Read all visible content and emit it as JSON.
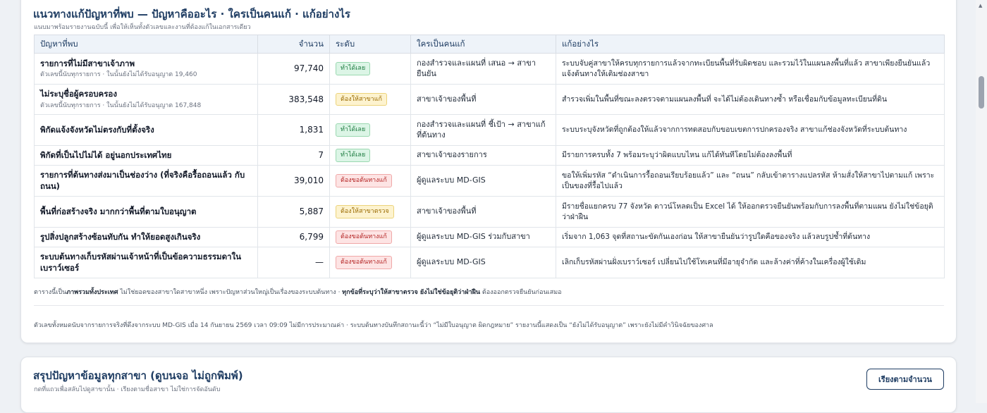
{
  "section1": {
    "title": "แนวทางแก้ปัญหาที่พบ — ปัญหาคืออะไร · ใครเป็นคนแก้ · แก้อย่างไร",
    "subtitle": "แนบมาพร้อมรายงานฉบับนี้ เพื่อให้เห็นทั้งตัวเลขและงานที่ต้องแก้ในเอกสารเดียว",
    "columns": {
      "problem": "ปัญหาที่พบ",
      "count": "จำนวน",
      "level": "ระดับ",
      "who": "ใครเป็นคนแก้",
      "how": "แก้อย่างไร"
    },
    "rows": [
      {
        "problem": "รายการที่ไม่มีสาขาเจ้าภาพ",
        "note": "ตัวเลขนี้นับทุกรายการ · ในนั้นยังไม่ได้รับอนุญาต 19,460",
        "count": "97,740",
        "level": "ทำได้เลย",
        "who": "กองสำรวจและแผนที่ เสนอ → สาขายืนยัน",
        "how": "ระบบจับคู่สาขาให้ครบทุกรายการแล้วจากทะเบียนพื้นที่รับผิดชอบ และรวมไว้ในแผนลงพื้นที่แล้ว สาขาเพียงยืนยันแล้วแจ้งต้นทางให้เติมช่องสาขา"
      },
      {
        "problem": "ไม่ระบุชื่อผู้ครอบครอง",
        "note": "ตัวเลขนี้นับทุกรายการ · ในนั้นยังไม่ได้รับอนุญาต 167,848",
        "count": "383,548",
        "level": "ต้องให้สาขาแก้",
        "who": "สาขาเจ้าของพื้นที่",
        "how": "สำรวจเพิ่มในพื้นที่ขณะลงตรวจตามแผนลงพื้นที่ จะได้ไม่ต้องเดินทางซ้ำ หรือเชื่อมกับข้อมูลทะเบียนที่ดิน"
      },
      {
        "problem": "พิกัดแจ้งจังหวัดไม่ตรงกับที่ตั้งจริง",
        "note": "",
        "count": "1,831",
        "level": "ทำได้เลย",
        "who": "กองสำรวจและแผนที่ ชี้เป้า → สาขาแก้ที่ต้นทาง",
        "how": "ระบบระบุจังหวัดที่ถูกต้องให้แล้วจากการทดสอบกับขอบเขตการปกครองจริง สาขาแก้ช่องจังหวัดที่ระบบต้นทาง"
      },
      {
        "problem": "พิกัดที่เป็นไปไม่ได้ อยู่นอกประเทศไทย",
        "note": "",
        "count": "7",
        "level": "ทำได้เลย",
        "who": "สาขาเจ้าของรายการ",
        "how": "มีรายการครบทั้ง 7 พร้อมระบุว่าผิดแบบไหน แก้ได้ทันทีโดยไม่ต้องลงพื้นที่"
      },
      {
        "problem": "รายการที่ต้นทางส่งมาเป็นช่องว่าง (ที่จริงคือรื้อถอนแล้ว กับถนน)",
        "note": "",
        "count": "39,010",
        "level": "ต้องขอต้นทางแก้",
        "who": "ผู้ดูแลระบบ MD-GIS",
        "how": "ขอให้เพิ่มรหัส “ดำเนินการรื้อถอนเรียบร้อยแล้ว” และ “ถนน” กลับเข้าตารางแปลรหัส ห้ามสั่งให้สาขาไปตามแก้ เพราะเป็นของที่รื้อไปแล้ว"
      },
      {
        "problem": "พื้นที่ก่อสร้างจริง มากกว่าพื้นที่ตามใบอนุญาต",
        "note": "",
        "count": "5,887",
        "level": "ต้องให้สาขาตรวจ",
        "who": "สาขาเจ้าของพื้นที่",
        "how": "มีรายชื่อแยกครบ 77 จังหวัด ดาวน์โหลดเป็น Excel ได้ ให้ออกตรวจยืนยันพร้อมกับการลงพื้นที่ตามแผน ยังไม่ใช่ข้อยุติว่าฝ่าฝืน"
      },
      {
        "problem": "รูปสิ่งปลูกสร้างซ้อนทับกัน ทำให้ยอดสูงเกินจริง",
        "note": "",
        "count": "6,799",
        "level": "ต้องขอต้นทางแก้",
        "who": "ผู้ดูแลระบบ MD-GIS ร่วมกับสาขา",
        "how": "เริ่มจาก 1,063 จุดที่สถานะขัดกันเองก่อน ให้สาขายืนยันว่ารูปใดคือของจริง แล้วลบรูปซ้ำที่ต้นทาง"
      },
      {
        "problem": "ระบบต้นทางเก็บรหัสผ่านเจ้าหน้าที่เป็นข้อความธรรมดาในเบราว์เซอร์",
        "note": "",
        "count": "—",
        "level": "ต้องขอต้นทางแก้",
        "who": "ผู้ดูแลระบบ MD-GIS",
        "how": "เลิกเก็บรหัสผ่านฝั่งเบราว์เซอร์ เปลี่ยนไปใช้โทเคนที่มีอายุจำกัด และล้างค่าที่ค้างในเครื่องผู้ใช้เดิม"
      }
    ],
    "footnote": {
      "p1": "ตารางนี้เป็น",
      "b1": "ภาพรวมทั้งประเทศ",
      "p2": " ไม่ใช่ยอดของสาขาใดสาขาหนึ่ง เพราะปัญหาส่วนใหญ่เป็นเรื่องของระบบต้นทาง · ",
      "b2": "ทุกข้อที่ระบุว่าให้สาขาตรวจ ยังไม่ใช่ข้อยุติว่าฝ่าฝืน",
      "p3": " ต้องออกตรวจยืนยันก่อนเสมอ"
    },
    "source_note": "ตัวเลขทั้งหมดนับจากรายการจริงที่ดึงจากระบบ MD-GIS เมื่อ 14 กันยายน 2569 เวลา 09:09 ไม่มีการประมาณค่า · ระบบต้นทางบันทึกสถานะนี้ว่า “ไม่มีใบอนุญาต ผิดกฎหมาย” รายงานนี้แสดงเป็น “ยังไม่ได้รับอนุญาต” เพราะยังไม่มีคำวินิจฉัยของศาล"
  },
  "section2": {
    "title": "สรุปปัญหาข้อมูลทุกสาขา (ดูบนจอ ไม่ถูกพิมพ์)",
    "subtitle": "กดที่แถวเพื่อสลับไปดูสาขานั้น · เรียงตามชื่อสาขา ไม่ใช่การจัดอันดับ",
    "sort_button": "เรียงตามจำนวน"
  },
  "level_styles": {
    "ทำได้เลย": "fix-now",
    "ต้องให้สาขาแก้": "branch",
    "ต้องให้สาขาตรวจ": "branch",
    "ต้องขอต้นทางแก้": "origin"
  },
  "colors": {
    "title": "#1f3d63",
    "badge_green": "#1b7a3e",
    "badge_yellow": "#9a6a00",
    "badge_red": "#b42323"
  }
}
